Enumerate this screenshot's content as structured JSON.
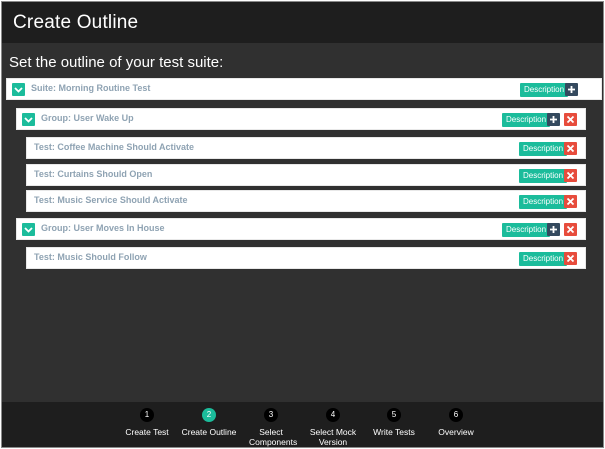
{
  "page": {
    "title": "Create Outline",
    "subtitle": "Set the outline of your test suite:"
  },
  "outline": {
    "suite": {
      "label": "Suite: Morning Routine Test",
      "description_label": "Description"
    },
    "group1": {
      "label": "Group: User Wake Up",
      "description_label": "Description"
    },
    "test1": {
      "label": "Test: Coffee Machine Should Activate",
      "description_label": "Description"
    },
    "test2": {
      "label": "Test: Curtains Should Open",
      "description_label": "Description"
    },
    "test3": {
      "label": "Test: Music Service Should Activate",
      "description_label": "Description"
    },
    "group2": {
      "label": "Group: User Moves In House",
      "description_label": "Description"
    },
    "test4": {
      "label": "Test: Music Should Follow",
      "description_label": "Description"
    }
  },
  "steps": [
    {
      "number": "1",
      "label": "Create Test"
    },
    {
      "number": "2",
      "label": "Create Outline"
    },
    {
      "number": "3",
      "label": "Select Components"
    },
    {
      "number": "4",
      "label": "Select Mock Version"
    },
    {
      "number": "5",
      "label": "Write Tests"
    },
    {
      "number": "6",
      "label": "Overview"
    }
  ],
  "active_step": 2,
  "colors": {
    "accent": "#1bbc9b",
    "delete": "#e74c3c",
    "add": "#34495e",
    "background": "#303030",
    "bar": "#1e1e1e"
  },
  "icons": {
    "expand": "chevron-down-icon",
    "add": "plus-icon",
    "delete": "close-icon"
  }
}
